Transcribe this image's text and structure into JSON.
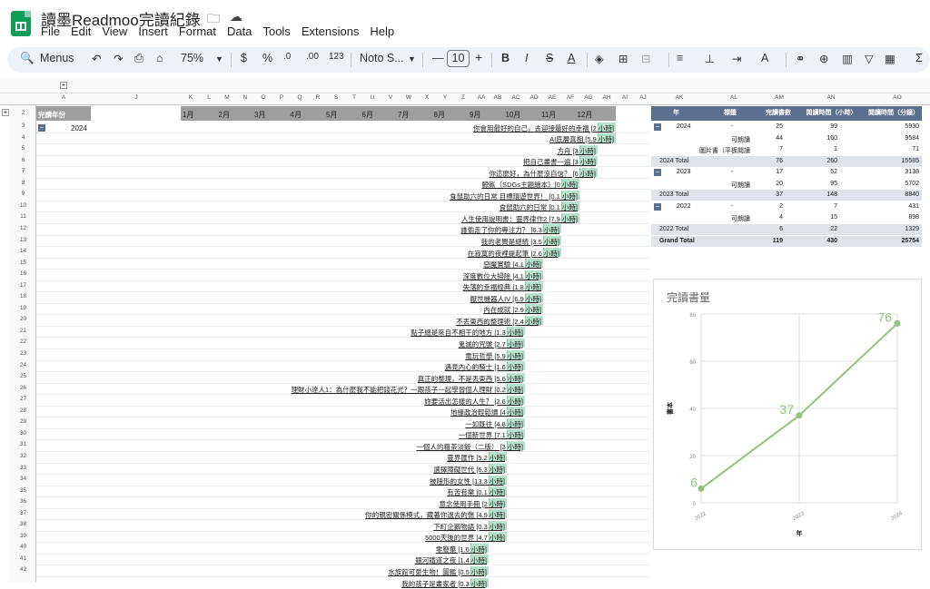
{
  "app": {
    "title": "讀墨Readmoo完讀紀錄"
  },
  "menu": [
    "File",
    "Edit",
    "View",
    "Insert",
    "Format",
    "Data",
    "Tools",
    "Extensions",
    "Help"
  ],
  "toolbar": {
    "menus_label": "Menus",
    "zoom": "75%",
    "currency": "$",
    "percent": "%",
    "dec_less": ".0",
    "dec_more": ".00",
    "number_fmt": "123",
    "font": "Noto S...",
    "font_size": "10",
    "bold": "B",
    "italic": "I",
    "sigma": "Σ"
  },
  "columns": [
    "A",
    "J",
    "K",
    "L",
    "M",
    "N",
    "O",
    "P",
    "Q",
    "R",
    "S",
    "T",
    "U",
    "V",
    "W",
    "X",
    "Y",
    "Z",
    "AA",
    "AB",
    "AC",
    "AD",
    "AE",
    "AF",
    "AG",
    "AH",
    "AI",
    "AJ",
    "AK",
    "AL",
    "AM",
    "AN",
    "AO"
  ],
  "rows": [
    "2",
    "3",
    "4",
    "5",
    "6",
    "7",
    "8",
    "9",
    "10",
    "11",
    "12",
    "13",
    "14",
    "15",
    "16",
    "17",
    "18",
    "19",
    "20",
    "21",
    "22",
    "23",
    "24",
    "25",
    "26",
    "27",
    "28",
    "29",
    "30",
    "31",
    "32",
    "33",
    "34",
    "35",
    "36",
    "37",
    "38",
    "39",
    "40",
    "41",
    "42"
  ],
  "header_label": "完讀年份",
  "year": "2024",
  "months": [
    "1月",
    "2月",
    "3月",
    "4月",
    "5月",
    "6月",
    "7月",
    "8月",
    "9月",
    "10月",
    "11月",
    "12月"
  ],
  "books": [
    "你會用最好的自己，去迎接最好的幸福 [2 小時]",
    "AI底層真相 [5.9 小時]",
    "方舟 [3 小時]",
    "把自己畫書一遍 [3 小時]",
    "你這麼好，為什麼沒自信？ [6 小時]",
    "鯨鯊（SDGs主題繪本）[0 小時]",
    "食鼠助六的日常 目標環遊世界！ [0.1 小時]",
    "食鼠助六的日常 [0.1 小時]",
    "人生使用說明書：靈界律作2 [7.9 小時]",
    "誰偷走了你的專注力？ [6.3 小時]",
    "我的老闆是總統 [3.5 小時]",
    "在寂寞的夜裡提起筆 [2.6 小時]",
    "惡魔實驗 [4.1 小時]",
    "深度數位大掃除 [4.1 小時]",
    "失落的幸福經典 [1.8 小時]",
    "厭世機器人IV [6.9 小時]",
    "內在成就 [2.9 小時]",
    "不丟東西的整理術 [2.4 小時]",
    "點子總是來自不相干的地方 [1.3 小時]",
    "鬼滅的咒號 [2.7 小時]",
    "電玩哲學 [5.9 小時]",
    "遇見內心的騎士 [1.6 小時]",
    "真正的整理，不是丟東西 [5.6 小時]",
    "理財小達人1：為什麼我不能把錢花光？一跟孩子一起學習個人理財 [0.2 小時]",
    "妳要活出怎樣的人生？ [2.6 小時]",
    "地緣政治輕鬆讀 [4 小時]",
    "一如既往 [4.8 小時]",
    "一個新世界 [7.1 小時]",
    "一個人的粗茶淡飯（二版） [3 小時]",
    "靈界匯作 [5.2 小時]",
    "選擇障礙世代 [6.3 小時]",
    "被隱形的女性 [13.3 小時]",
    "有苦有樂 [0.1 小時]",
    "意念使用手冊 [2 小時]",
    "你的親密關係模式，藏著你過去的傷 [4.9 小時]",
    "下町企鵝物語 [0.3 小時]",
    "5000天後的世界 [4.7 小時]",
    "零廢棄 [1.6 小時]",
    "銀河鐵道之夜 [1.4 小時]",
    "水族館可愛生物！圖鑑 [0.5 小時]",
    "我的孩子是畫家者 [0.3 小時]"
  ],
  "pivot": {
    "headers": [
      "年",
      "標籤",
      "完讀書數",
      "閱讀時間（小時）",
      "閱讀時間（分鐘）"
    ],
    "cols_letters": [
      "AK",
      "AL",
      "AM",
      "AN",
      "AO"
    ],
    "rows": [
      {
        "year": "2024",
        "tag": "-",
        "count": "25",
        "hours": "99",
        "minutes": "5930"
      },
      {
        "year": "",
        "tag": "可朗讀",
        "count": "44",
        "hours": "160",
        "minutes": "9584"
      },
      {
        "year": "",
        "tag": "圖片書（平板閱讀",
        "count": "7",
        "hours": "1",
        "minutes": "71"
      },
      {
        "year": "2024 Total",
        "tag": "",
        "count": "76",
        "hours": "260",
        "minutes": "15585",
        "total": true
      },
      {
        "year": "2023",
        "tag": "-",
        "count": "17",
        "hours": "52",
        "minutes": "3138"
      },
      {
        "year": "",
        "tag": "可朗讀",
        "count": "20",
        "hours": "95",
        "minutes": "5702"
      },
      {
        "year": "2023 Total",
        "tag": "",
        "count": "37",
        "hours": "148",
        "minutes": "8840",
        "total": true
      },
      {
        "year": "2022",
        "tag": "-",
        "count": "2",
        "hours": "7",
        "minutes": "431"
      },
      {
        "year": "",
        "tag": "可朗讀",
        "count": "4",
        "hours": "15",
        "minutes": "898"
      },
      {
        "year": "2022 Total",
        "tag": "",
        "count": "6",
        "hours": "22",
        "minutes": "1329",
        "total": true
      },
      {
        "year": "Grand Total",
        "tag": "",
        "count": "119",
        "hours": "430",
        "minutes": "25754",
        "total": true
      }
    ]
  },
  "chart_data": {
    "type": "line",
    "title": "完讀書量",
    "xlabel": "年",
    "ylabel": "書本",
    "x": [
      "2022",
      "2023",
      "2024"
    ],
    "series": [
      {
        "values": [
          6,
          37,
          76
        ]
      }
    ],
    "data_labels": [
      "6",
      "37",
      "76"
    ],
    "ylim": [
      0,
      80
    ],
    "yticks": [
      "0",
      "20",
      "40",
      "60",
      "80"
    ],
    "grid": true,
    "color": "#93c47d"
  }
}
